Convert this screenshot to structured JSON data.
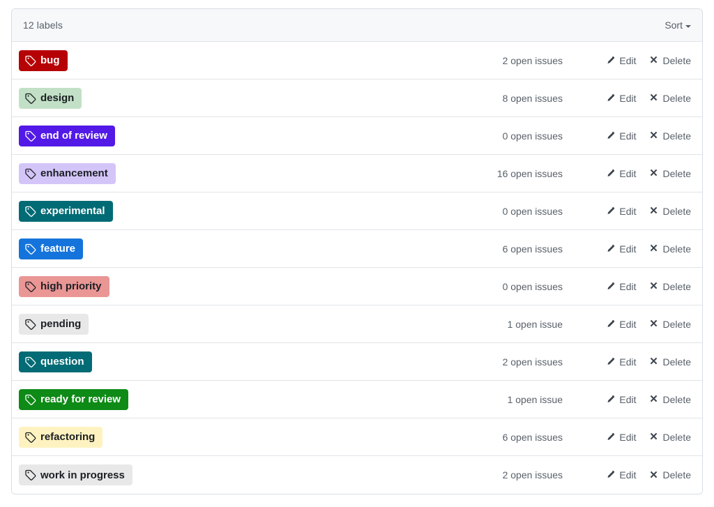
{
  "header": {
    "count_text": "12 labels",
    "sort_label": "Sort",
    "sort_icon": "chevron-down-icon",
    "background": "#f6f8fa"
  },
  "icons": {
    "tag": "tag-icon",
    "edit": "pencil-icon",
    "delete": "close-x-icon"
  },
  "actions": {
    "edit_label": "Edit",
    "delete_label": "Delete"
  },
  "labels": [
    {
      "name": "bug",
      "open_issues_text": "2 open issues",
      "bg": "#b60205",
      "fg": "#ffffff"
    },
    {
      "name": "design",
      "open_issues_text": "8 open issues",
      "bg": "#c2e0c6",
      "fg": "#1b1f23"
    },
    {
      "name": "end of review",
      "open_issues_text": "0 open issues",
      "bg": "#5319e7",
      "fg": "#ffffff"
    },
    {
      "name": "enhancement",
      "open_issues_text": "16 open issues",
      "bg": "#d4c5f9",
      "fg": "#1b1f23"
    },
    {
      "name": "experimental",
      "open_issues_text": "0 open issues",
      "bg": "#006b75",
      "fg": "#ffffff"
    },
    {
      "name": "feature",
      "open_issues_text": "6 open issues",
      "bg": "#1574db",
      "fg": "#ffffff"
    },
    {
      "name": "high priority",
      "open_issues_text": "0 open issues",
      "bg": "#e99695",
      "fg": "#1b1f23"
    },
    {
      "name": "pending",
      "open_issues_text": "1 open issue",
      "bg": "#e8e8e8",
      "fg": "#1b1f23"
    },
    {
      "name": "question",
      "open_issues_text": "2 open issues",
      "bg": "#026b75",
      "fg": "#ffffff"
    },
    {
      "name": "ready for review",
      "open_issues_text": "1 open issue",
      "bg": "#0e8a16",
      "fg": "#ffffff"
    },
    {
      "name": "refactoring",
      "open_issues_text": "6 open issues",
      "bg": "#fef2c0",
      "fg": "#1b1f23"
    },
    {
      "name": "work in progress",
      "open_issues_text": "2 open issues",
      "bg": "#e8e8e8",
      "fg": "#1b1f23"
    }
  ]
}
